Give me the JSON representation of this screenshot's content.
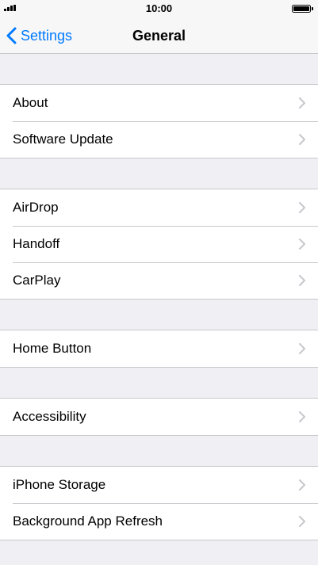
{
  "status_bar": {
    "time": "10:00",
    "signal_icon": "signal-bars-icon",
    "battery_icon": "battery-icon"
  },
  "nav": {
    "back_label": "Settings",
    "back_icon": "chevron-left-icon",
    "title": "General"
  },
  "accent_color": "#007aff",
  "groups": [
    {
      "items": [
        {
          "label": "About"
        },
        {
          "label": "Software Update"
        }
      ]
    },
    {
      "items": [
        {
          "label": "AirDrop"
        },
        {
          "label": "Handoff"
        },
        {
          "label": "CarPlay"
        }
      ]
    },
    {
      "items": [
        {
          "label": "Home Button"
        }
      ]
    },
    {
      "items": [
        {
          "label": "Accessibility"
        }
      ]
    },
    {
      "items": [
        {
          "label": "iPhone Storage"
        },
        {
          "label": "Background App Refresh"
        }
      ]
    }
  ]
}
